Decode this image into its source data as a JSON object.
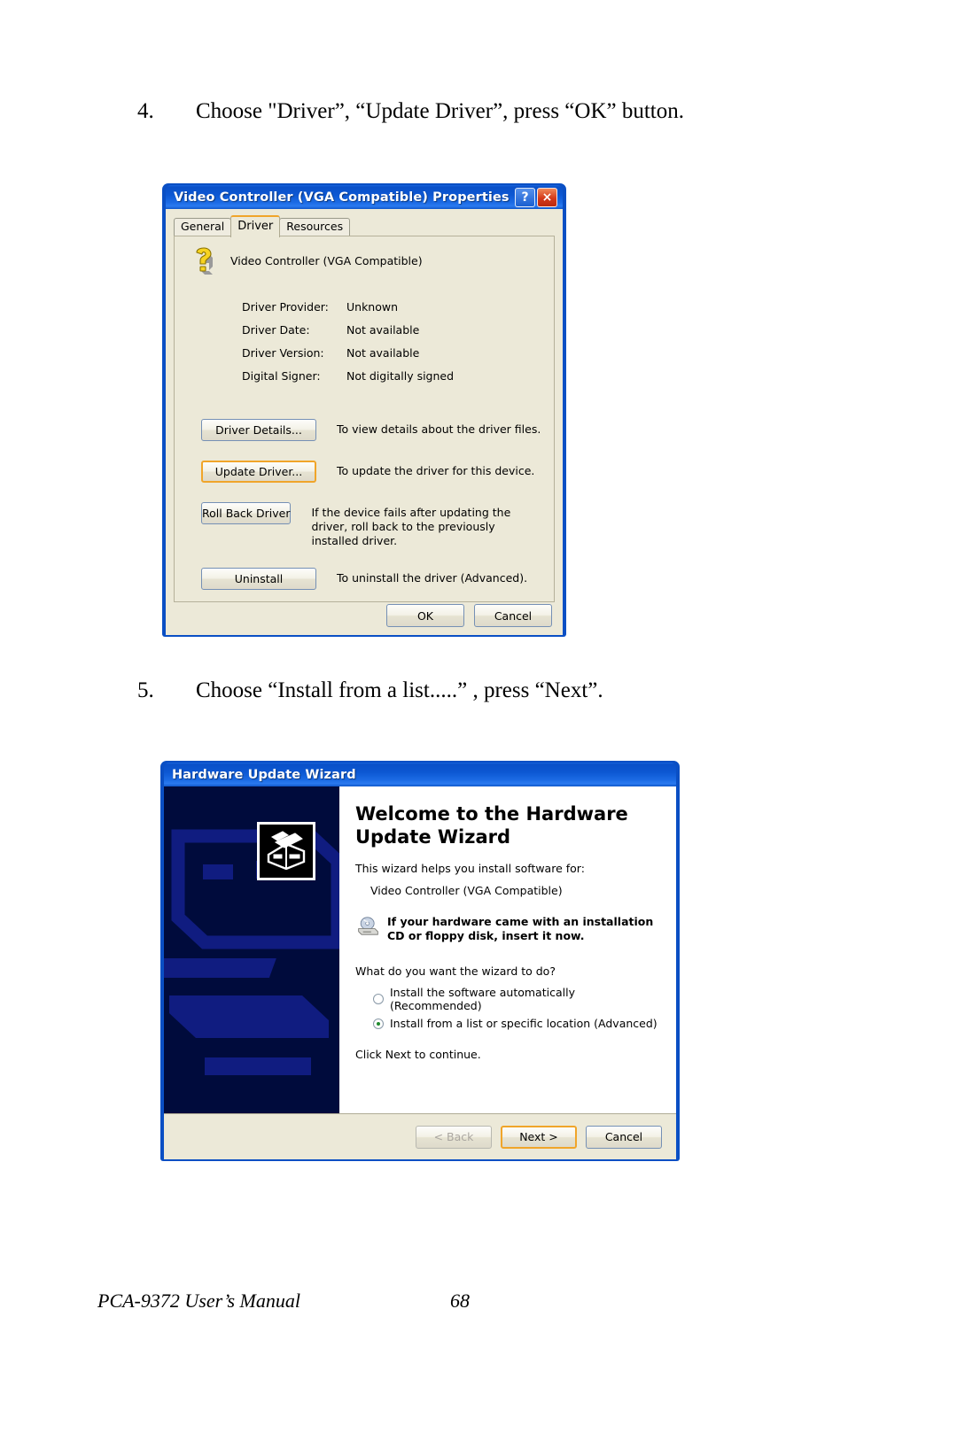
{
  "steps": [
    {
      "num": "4.",
      "text": "Choose \"Driver”, “Update Driver”, press “OK” button."
    },
    {
      "num": "5.",
      "text": "Choose “Install from a list.....” , press “Next”."
    }
  ],
  "properties_dialog": {
    "title": "Video Controller (VGA Compatible) Properties",
    "help_button": "?",
    "close_button": "×",
    "tabs": [
      {
        "label": "General",
        "active": false
      },
      {
        "label": "Driver",
        "active": true
      },
      {
        "label": "Resources",
        "active": false
      }
    ],
    "device_name": "Video Controller (VGA Compatible)",
    "device_icon": "unknown-device-question-icon",
    "info": [
      {
        "key": "Driver Provider:",
        "value": "Unknown"
      },
      {
        "key": "Driver Date:",
        "value": "Not available"
      },
      {
        "key": "Driver Version:",
        "value": "Not available"
      },
      {
        "key": "Digital Signer:",
        "value": "Not digitally signed"
      }
    ],
    "actions": [
      {
        "button": "Driver Details...",
        "description": "To view details about the driver files.",
        "focused": false
      },
      {
        "button": "Update Driver...",
        "description": "To update the driver for this device.",
        "focused": true
      },
      {
        "button": "Roll Back Driver",
        "description": "If the device fails after updating the driver, roll back to the previously installed driver.",
        "focused": false
      },
      {
        "button": "Uninstall",
        "description": "To uninstall the driver (Advanced).",
        "focused": false
      }
    ],
    "ok_label": "OK",
    "cancel_label": "Cancel"
  },
  "wizard_dialog": {
    "title": "Hardware Update Wizard",
    "heading": "Welcome to the Hardware Update Wizard",
    "intro": "This wizard helps you install software for:",
    "device_name": "Video Controller (VGA Compatible)",
    "cd_icon": "cd-drive-icon",
    "cd_notice": "If your hardware came with an installation CD or floppy disk, insert it now.",
    "question": "What do you want the wizard to do?",
    "options": [
      {
        "label": "Install the software automatically (Recommended)",
        "selected": false
      },
      {
        "label": "Install from a list or specific location (Advanced)",
        "selected": true
      }
    ],
    "continue_text": "Click Next to continue.",
    "back_label": "< Back",
    "next_label": "Next >",
    "cancel_label": "Cancel",
    "back_disabled": true,
    "next_focused": true
  },
  "page_footer": {
    "manual_title": "PCA-9372 User’s Manual",
    "page_number": "68"
  },
  "colors": {
    "titlebar_blue": "#0a50c8",
    "dialog_face": "#ece9d8",
    "focus_orange": "#f0a52a",
    "wizard_panel_navy": "#000b3c",
    "radio_green": "#1f8a2e",
    "close_red": "#d4391a"
  }
}
